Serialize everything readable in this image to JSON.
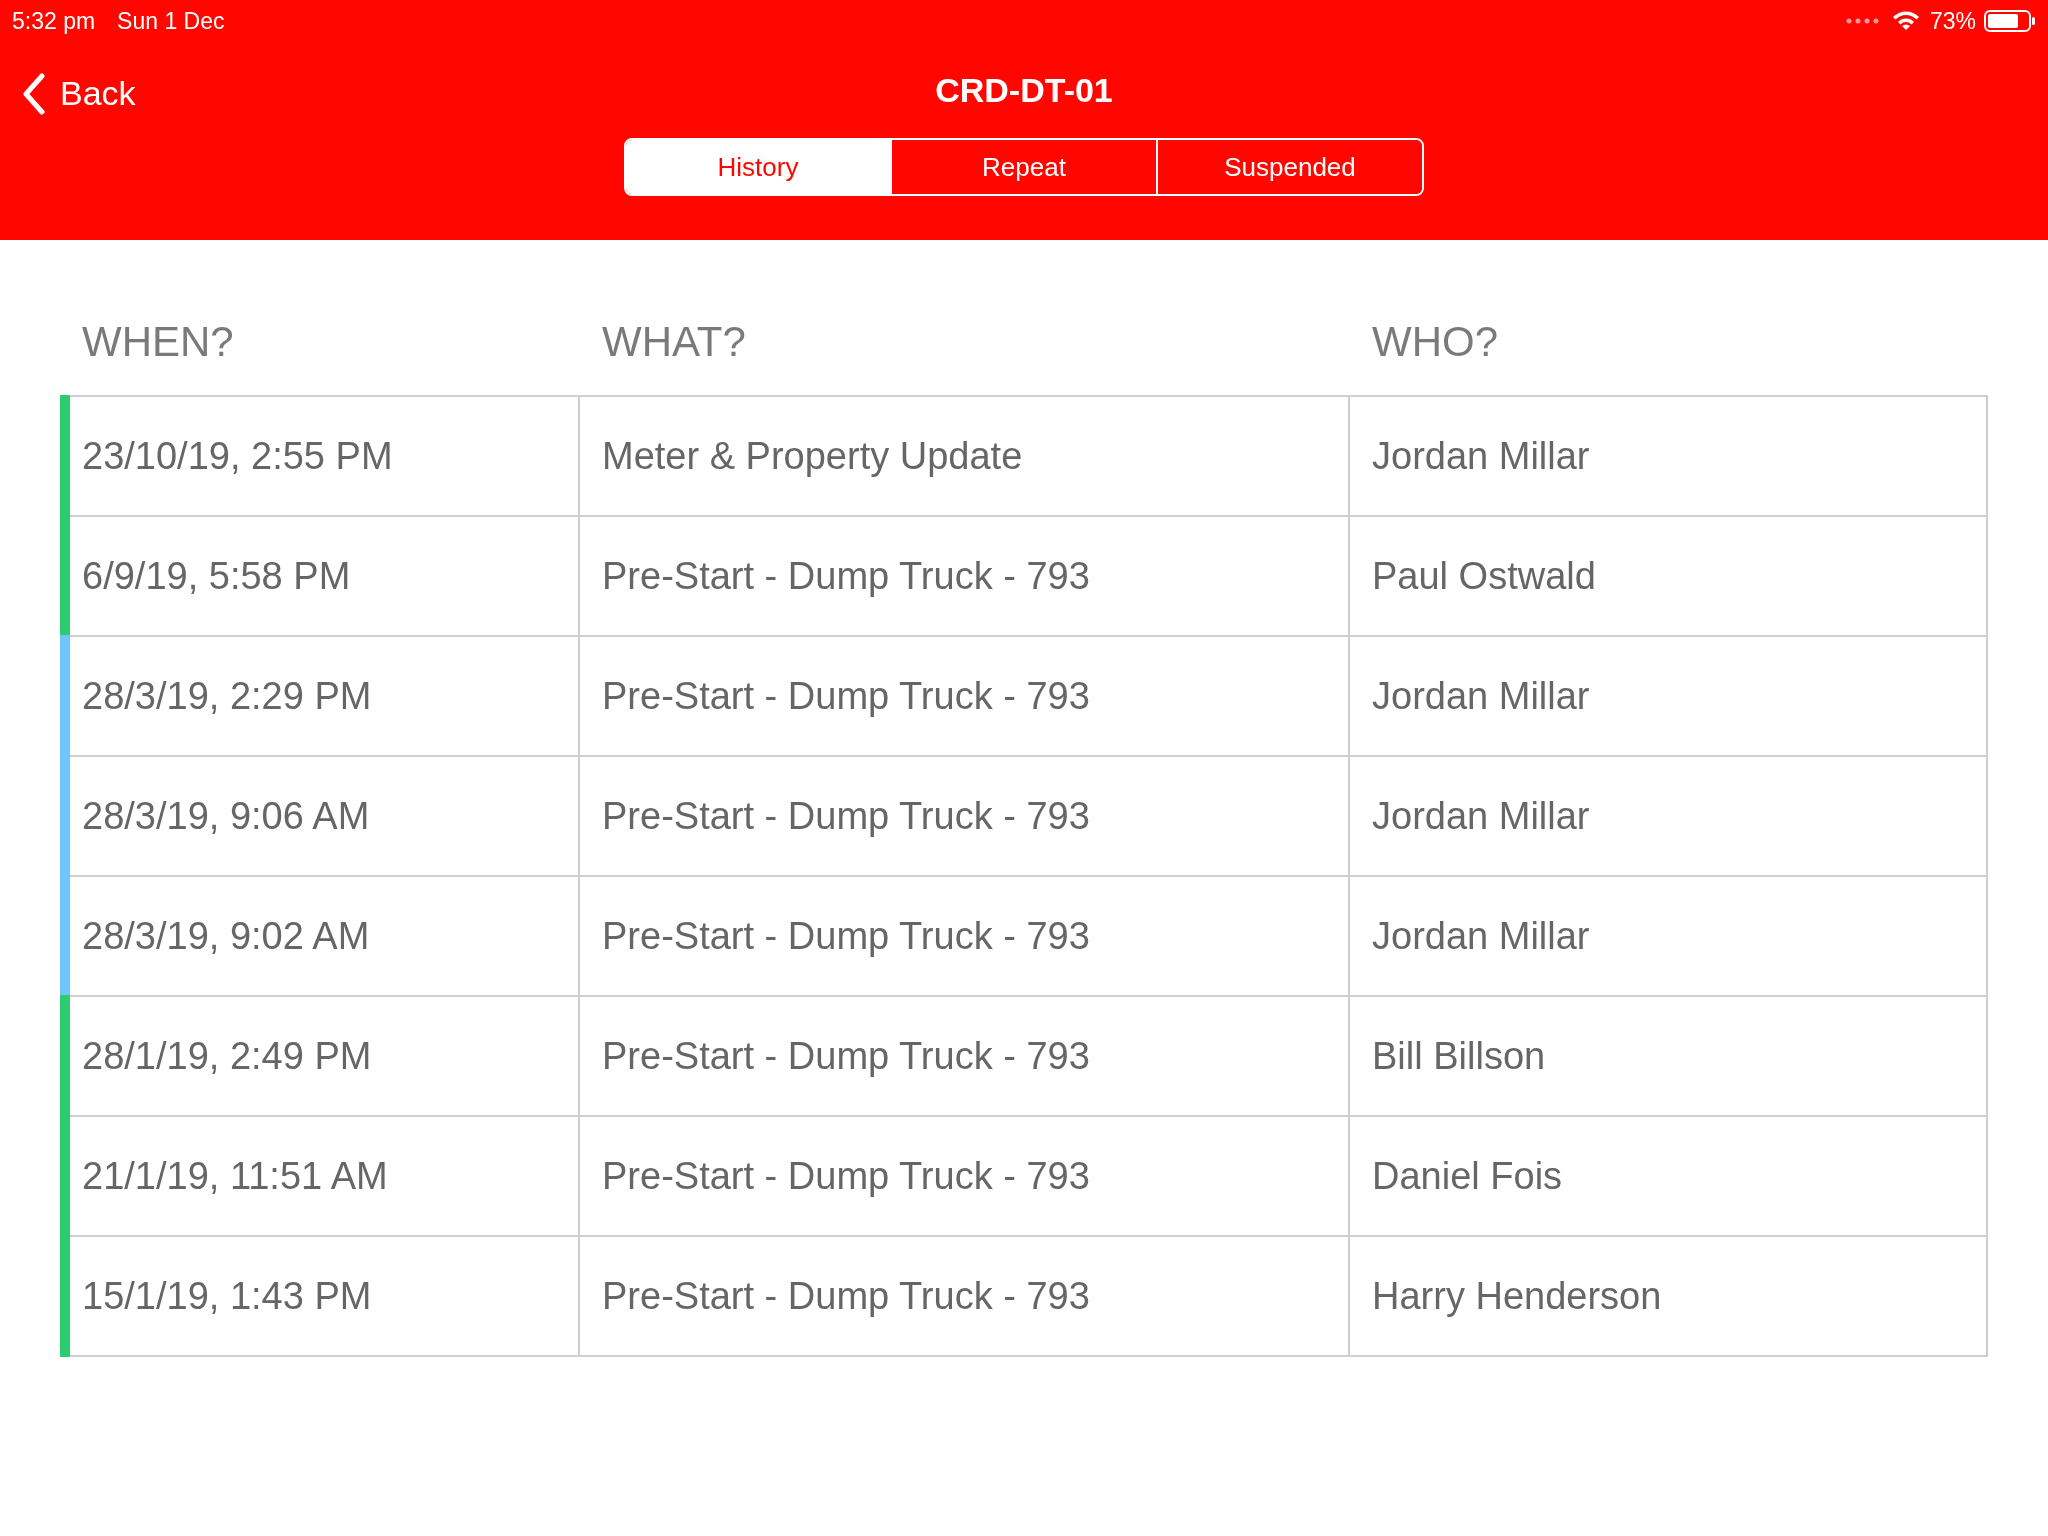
{
  "status_bar": {
    "time": "5:32 pm",
    "date": "Sun 1 Dec",
    "battery": "73%"
  },
  "nav": {
    "back": "Back",
    "title": "CRD-DT-01"
  },
  "tabs": [
    {
      "label": "History",
      "selected": true
    },
    {
      "label": "Repeat",
      "selected": false
    },
    {
      "label": "Suspended",
      "selected": false
    }
  ],
  "table": {
    "columns": [
      "WHEN?",
      "WHAT?",
      "WHO?"
    ],
    "rows": [
      {
        "when": "23/10/19, 2:55 PM",
        "what": "Meter & Property Update",
        "who": "Jordan Millar",
        "color": "#2ecc71"
      },
      {
        "when": "6/9/19, 5:58 PM",
        "what": "Pre-Start - Dump Truck - 793",
        "who": "Paul Ostwald",
        "color": "#2ecc71"
      },
      {
        "when": "28/3/19, 2:29 PM",
        "what": "Pre-Start - Dump Truck - 793",
        "who": "Jordan Millar",
        "color": "#6ec6fa"
      },
      {
        "when": "28/3/19, 9:06 AM",
        "what": "Pre-Start - Dump Truck - 793",
        "who": "Jordan Millar",
        "color": "#6ec6fa"
      },
      {
        "when": "28/3/19, 9:02 AM",
        "what": "Pre-Start - Dump Truck - 793",
        "who": "Jordan Millar",
        "color": "#6ec6fa"
      },
      {
        "when": "28/1/19, 2:49 PM",
        "what": "Pre-Start - Dump Truck - 793",
        "who": "Bill Billson",
        "color": "#2ecc71"
      },
      {
        "when": "21/1/19, 11:51 AM",
        "what": "Pre-Start - Dump Truck - 793",
        "who": "Daniel Fois",
        "color": "#2ecc71"
      },
      {
        "when": "15/1/19, 1:43 PM",
        "what": "Pre-Start - Dump Truck - 793",
        "who": "Harry Henderson",
        "color": "#2ecc71"
      }
    ]
  }
}
